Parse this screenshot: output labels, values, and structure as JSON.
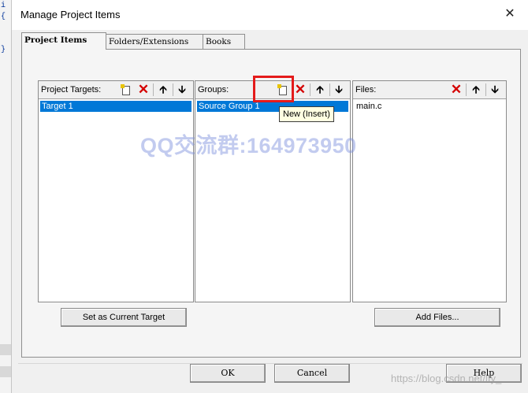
{
  "editor": {
    "lines": [
      "i",
      "{",
      "",
      "}"
    ]
  },
  "window": {
    "title": "Manage Project Items",
    "close_label": "✕"
  },
  "tabs": [
    {
      "label": "Project Items",
      "active": true
    },
    {
      "label": "Folders/Extensions",
      "active": false
    },
    {
      "label": "Books",
      "active": false
    }
  ],
  "panels": {
    "targets": {
      "label": "Project Targets:",
      "items": [
        "Target 1"
      ],
      "selected": "Target 1"
    },
    "groups": {
      "label": "Groups:",
      "items": [
        "Source Group 1"
      ],
      "selected": "Source Group 1"
    },
    "files": {
      "label": "Files:",
      "items": [
        "main.c"
      ]
    }
  },
  "toolbar_icons": {
    "new": "new-document-icon",
    "delete": "delete-x-icon",
    "up": "move-up-arrow-icon",
    "down": "move-down-arrow-icon"
  },
  "tooltip": {
    "text": "New (Insert)"
  },
  "buttons": {
    "set_current_target": "Set as Current Target",
    "add_files": "Add Files...",
    "ok": "OK",
    "cancel": "Cancel",
    "help": "Help"
  },
  "watermark": {
    "text": "QQ交流群:164973950",
    "url": "https://blog.csdn.net/lfy_"
  },
  "colors": {
    "selection": "#0078d7",
    "highlight": "#e41b1b",
    "delete": "#d40000",
    "tooltip_bg": "#ffffe1"
  }
}
